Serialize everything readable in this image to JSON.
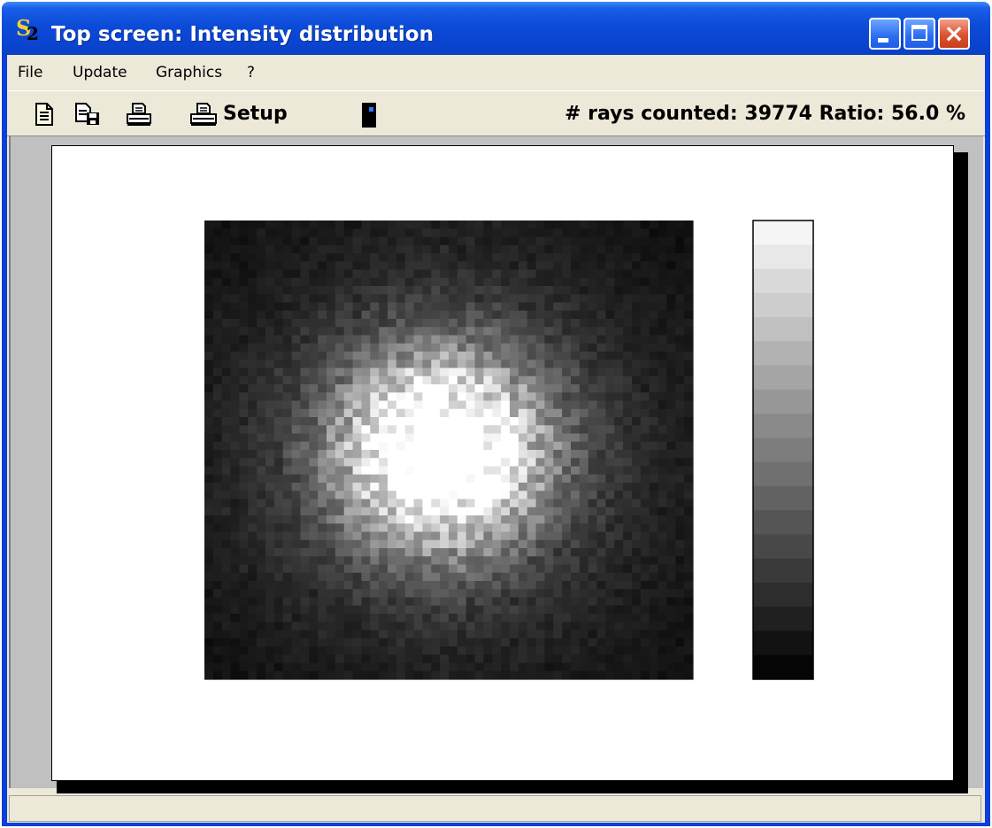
{
  "window": {
    "title": "Top screen: Intensity distribution",
    "icon_name": "s2-app-icon",
    "icon_glyph_s": "S",
    "icon_glyph_2": "2",
    "close_glyph": "×"
  },
  "menu": {
    "items": [
      {
        "label": "File"
      },
      {
        "label": "Update"
      },
      {
        "label": "Graphics"
      },
      {
        "label": "?"
      }
    ]
  },
  "toolbar": {
    "icons": [
      "new-document-icon",
      "save-document-icon",
      "print-icon",
      "printer-setup-icon",
      "exit-door-icon"
    ],
    "setup_label": "Setup",
    "status": "# rays counted: 39774 Ratio: 56.0 %"
  },
  "image": {
    "type": "grayscale-intensity-map",
    "grid": 56,
    "seed": 39774,
    "peak": "center"
  },
  "colorscale": {
    "levels": 19,
    "order": "light-top-dark-bottom"
  },
  "statusbar": {
    "text": ""
  }
}
